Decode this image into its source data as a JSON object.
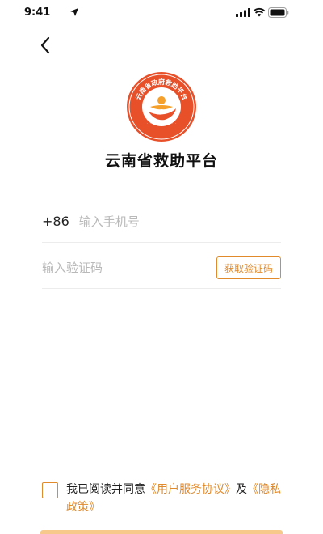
{
  "status_bar": {
    "time": "9:41"
  },
  "logo": {
    "arc_text": "云南省政府救助平台"
  },
  "app": {
    "title": "云南省救助平台"
  },
  "login": {
    "country_code": "+86",
    "phone_placeholder": "输入手机号",
    "code_placeholder": "输入验证码",
    "get_code_label": "获取验证码"
  },
  "agreement": {
    "prefix": "我已阅读并同意",
    "user_agreement": "《用户服务协议》",
    "conjunction": "及",
    "privacy_policy": "《隐私政策》"
  },
  "colors": {
    "accent": "#e08a2c",
    "logo_red": "#e8502a",
    "logo_orange": "#f5a02a"
  },
  "icons": [
    "location-arrow-icon",
    "signal-icon",
    "wifi-icon",
    "battery-icon",
    "back-chevron-icon"
  ]
}
